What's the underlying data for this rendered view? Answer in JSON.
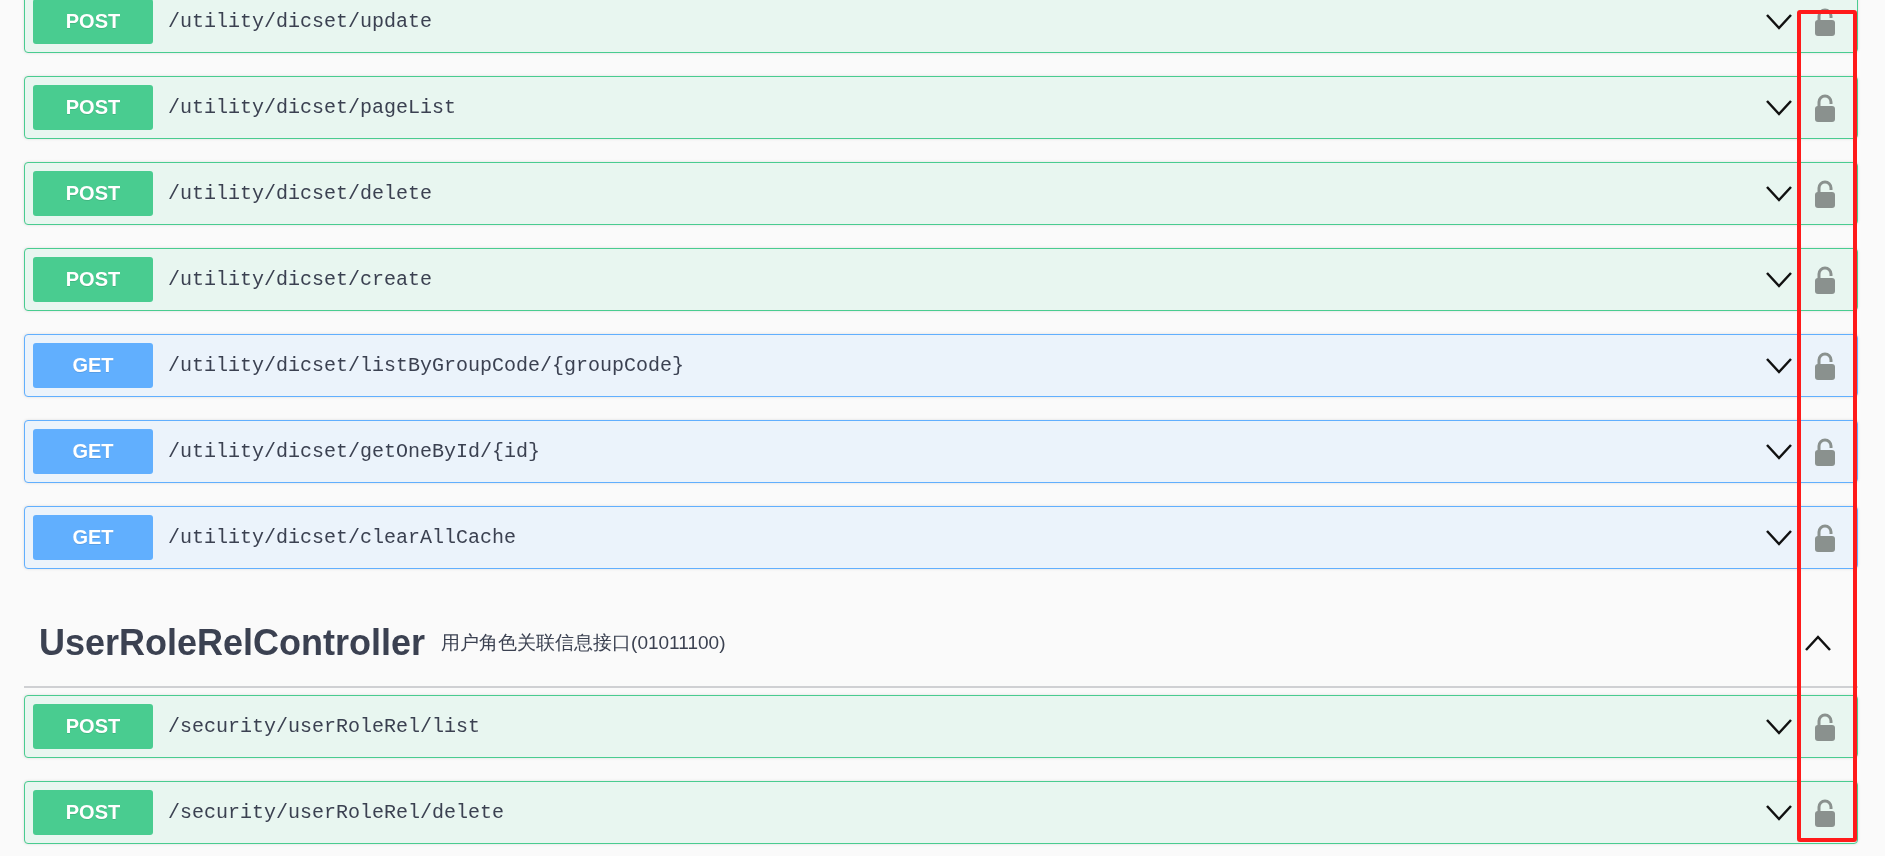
{
  "operations_top": [
    {
      "method": "POST",
      "path": "/utility/dicset/update",
      "expanded": false,
      "locked": false
    },
    {
      "method": "POST",
      "path": "/utility/dicset/pageList",
      "expanded": false,
      "locked": false
    },
    {
      "method": "POST",
      "path": "/utility/dicset/delete",
      "expanded": false,
      "locked": false
    },
    {
      "method": "POST",
      "path": "/utility/dicset/create",
      "expanded": false,
      "locked": false
    },
    {
      "method": "GET",
      "path": "/utility/dicset/listByGroupCode/{groupCode}",
      "expanded": false,
      "locked": false
    },
    {
      "method": "GET",
      "path": "/utility/dicset/getOneById/{id}",
      "expanded": false,
      "locked": false
    },
    {
      "method": "GET",
      "path": "/utility/dicset/clearAllCache",
      "expanded": false,
      "locked": false
    }
  ],
  "section": {
    "title": "UserRoleRelController",
    "description": "用户角色关联信息接口(01011100)",
    "expanded": true,
    "operations": [
      {
        "method": "POST",
        "path": "/security/userRoleRel/list",
        "expanded": false,
        "locked": false
      },
      {
        "method": "POST",
        "path": "/security/userRoleRel/delete",
        "expanded": false,
        "locked": false
      }
    ]
  },
  "highlight": {
    "kind": "frame"
  }
}
